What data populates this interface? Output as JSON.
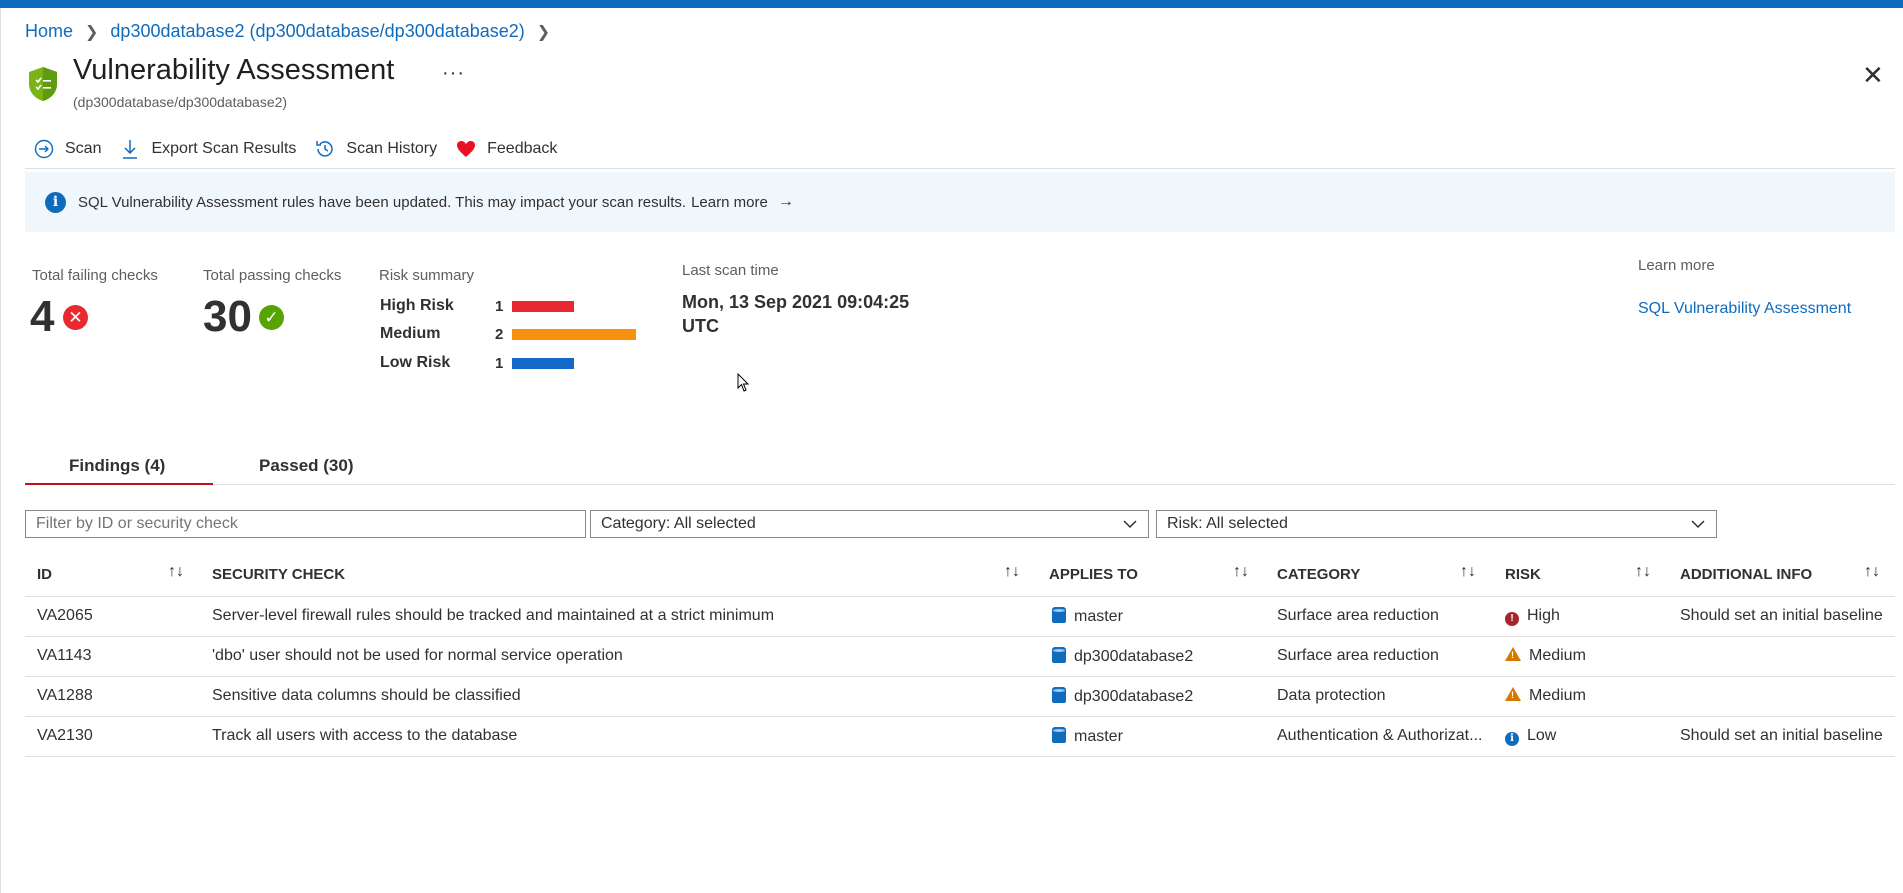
{
  "breadcrumb": {
    "home": "Home",
    "resource": "dp300database2 (dp300database/dp300database2)"
  },
  "header": {
    "title": "Vulnerability Assessment",
    "subtitle": "(dp300database/dp300database2)",
    "more": "···",
    "close": "✕"
  },
  "toolbar": {
    "scan": "Scan",
    "export": "Export Scan Results",
    "history": "Scan History",
    "feedback": "Feedback"
  },
  "banner": {
    "message": "SQL Vulnerability Assessment rules have been updated. This may impact your scan results.",
    "learn_more": "Learn more",
    "arrow": "→"
  },
  "summary": {
    "failing_label": "Total failing checks",
    "failing_count": "4",
    "passing_label": "Total passing checks",
    "passing_count": "30",
    "risk_label": "Risk summary",
    "risks": [
      {
        "name": "High Risk",
        "count": "1",
        "value": 1,
        "color": "#e8292f"
      },
      {
        "name": "Medium",
        "count": "2",
        "value": 2,
        "color": "#f7900f"
      },
      {
        "name": "Low Risk",
        "count": "1",
        "value": 1,
        "color": "#1468c7"
      }
    ],
    "scan_label": "Last scan time",
    "scan_time": "Mon, 13 Sep 2021 09:04:25 UTC",
    "learn_label": "Learn more",
    "learn_link": "SQL Vulnerability Assessment"
  },
  "tabs": {
    "findings": "Findings (4)",
    "passed": "Passed (30)"
  },
  "filters": {
    "search_placeholder": "Filter by ID or security check",
    "category": "Category: All selected",
    "risk": "Risk: All selected"
  },
  "table": {
    "headers": {
      "id": "ID",
      "check": "SECURITY CHECK",
      "applies": "APPLIES TO",
      "category": "CATEGORY",
      "risk": "RISK",
      "info": "ADDITIONAL INFO"
    },
    "sort_icon": "↑↓",
    "rows": [
      {
        "id": "VA2065",
        "check": "Server-level firewall rules should be tracked and maintained at a strict minimum",
        "applies": "master",
        "category": "Surface area reduction",
        "risk": "High",
        "info": "Should set an initial baseline"
      },
      {
        "id": "VA1143",
        "check": "'dbo' user should not be used for normal service operation",
        "applies": "dp300database2",
        "category": "Surface area reduction",
        "risk": "Medium",
        "info": ""
      },
      {
        "id": "VA1288",
        "check": "Sensitive data columns should be classified",
        "applies": "dp300database2",
        "category": "Data protection",
        "risk": "Medium",
        "info": ""
      },
      {
        "id": "VA2130",
        "check": "Track all users with access to the database",
        "applies": "master",
        "category": "Authentication & Authorizat...",
        "risk": "Low",
        "info": "Should set an initial baseline"
      }
    ]
  }
}
